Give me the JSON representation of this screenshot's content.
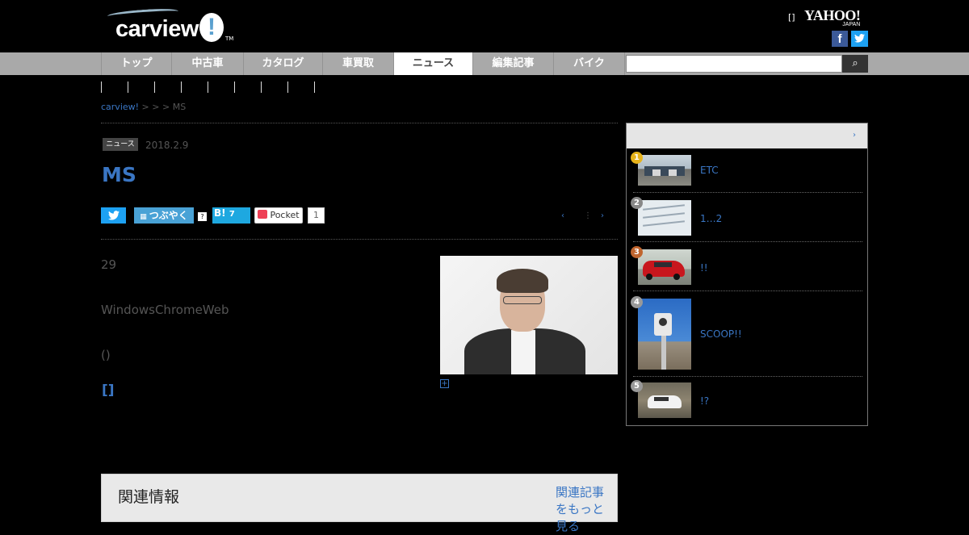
{
  "header": {
    "logo_text": "carview",
    "logo_bang": "!",
    "logo_tm": "TM",
    "yahoo_bracket": "[]",
    "yahoo_text": "YAHOO!",
    "yahoo_sub": "JAPAN",
    "facebook_glyph": "f",
    "twitter_glyph": "🐦"
  },
  "nav": {
    "items": [
      "トップ",
      "中古車",
      "カタログ",
      "車買取",
      "ニュース",
      "編集記事",
      "バイク"
    ],
    "active": "ニュース",
    "search_placeholder": "",
    "search_glyph": "⌕"
  },
  "breadcrumb": {
    "home": "carview!",
    "rest": " >  > > MS"
  },
  "article": {
    "category": "ニュース記事",
    "date": "2018.2.9",
    "title": "MS",
    "paragraphs": [
      "29",
      "WindowsChromeWeb",
      "()"
    ],
    "more_link": "[]",
    "share": {
      "tweet_glyph": "🐦",
      "mixi_label": "つぶやく",
      "mixi_help": "?",
      "hatena_label": "B!",
      "hatena_count": "7",
      "pocket_label": "Pocket",
      "pocket_count": "1"
    },
    "pager": {
      "prev": "‹",
      "sep": "⋮",
      "next": "›"
    },
    "zoom_glyph": "+"
  },
  "bottom": {
    "title": "関連情報",
    "link": "関連記事をもっと見る"
  },
  "ranking": {
    "more": "›",
    "items": [
      {
        "rank": "1",
        "title": "ETC",
        "badge_color": "#e6b31b",
        "thumb": "toll-gate"
      },
      {
        "rank": "2",
        "title": "1…2",
        "badge_color": "#888888",
        "thumb": "paper-form"
      },
      {
        "rank": "3",
        "title": "!!",
        "badge_color": "#c0652e",
        "thumb": "red-car"
      },
      {
        "rank": "4",
        "title": "SCOOP!!",
        "badge_color": "#999999",
        "thumb": "speed-camera"
      },
      {
        "rank": "5",
        "title": "!?",
        "badge_color": "#999999",
        "thumb": "white-car"
      }
    ]
  }
}
